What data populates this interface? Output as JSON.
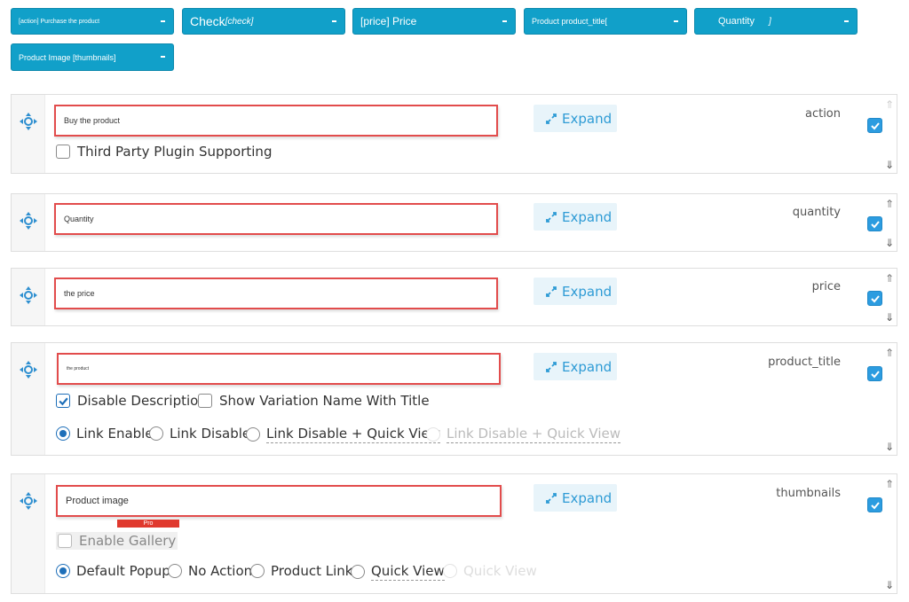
{
  "fields": [
    {
      "label": "[action] Purchase the product",
      "suffix": ""
    },
    {
      "label": "Check",
      "suffix": "[check]"
    },
    {
      "label": "[price] Price",
      "suffix": ""
    },
    {
      "label": "Product product_title[",
      "suffix": ""
    },
    {
      "label": "Quantity",
      "suffix": "]"
    },
    {
      "label": "Product Image [thumbnails]",
      "suffix": ""
    }
  ],
  "expand_label": "Expand",
  "arrows": {
    "up": "⇑",
    "down": "⇓"
  },
  "rows": {
    "action": {
      "input_value": "Buy the product",
      "key": "action",
      "option": "Third Party Plugin Supporting"
    },
    "quantity": {
      "input_value": "Quantity",
      "key": "quantity"
    },
    "price": {
      "input_value": "the price",
      "key": "price"
    },
    "product_title": {
      "input_value": "the product",
      "key": "product_title",
      "options": {
        "disable_description": "Disable Description",
        "show_variation": "Show Variation Name With Title",
        "link_enable": "Link Enable",
        "link_disable": "Link Disable",
        "link_disable_qv": "Link Disable + Quick View",
        "link_disable_qv2": "Link Disable + Quick View"
      }
    },
    "thumbnails": {
      "input_value": "Product image",
      "key": "thumbnails",
      "pro_badge": "Pro",
      "options": {
        "enable_gallery": "Enable Gallery",
        "default_popup": "Default Popup",
        "no_action": "No Action",
        "product_link": "Product Link",
        "quick_view": "Quick View",
        "quick_view2": "Quick View"
      }
    }
  },
  "colors": {
    "chip": "#11a0c9",
    "input_border": "#e24c4c",
    "expand_bg": "#e8f4fa",
    "expand_text": "#2e9bd5",
    "checkbox": "#2c9ce0",
    "pro": "#e0392e"
  }
}
